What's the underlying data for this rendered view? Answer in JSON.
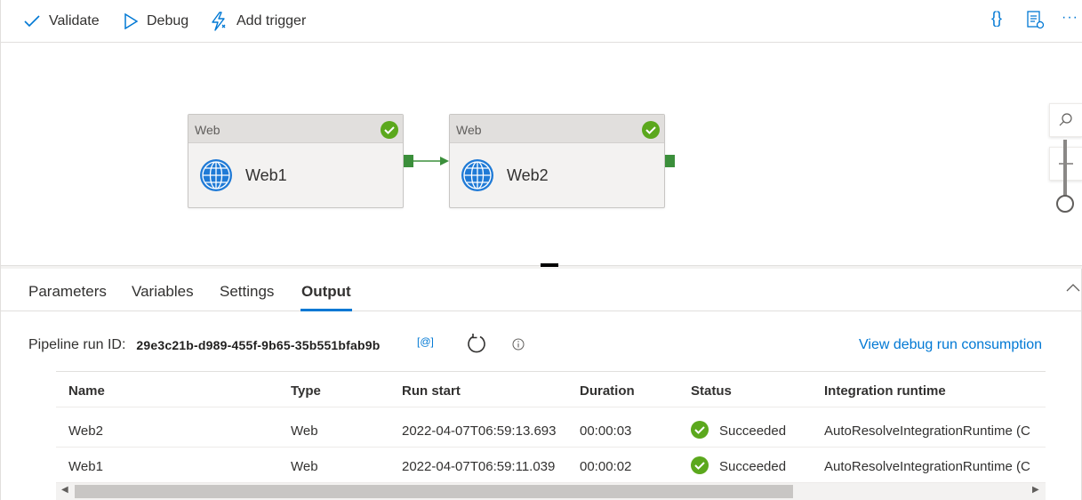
{
  "toolbar": {
    "validate_label": "Validate",
    "debug_label": "Debug",
    "add_trigger_label": "Add trigger",
    "code_icon_text": "{}",
    "more_icon_text": "···"
  },
  "canvas": {
    "activities": [
      {
        "type": "Web",
        "name": "Web1",
        "status": "succeeded"
      },
      {
        "type": "Web",
        "name": "Web2",
        "status": "succeeded"
      }
    ]
  },
  "tabs": [
    {
      "label": "Parameters",
      "active": false
    },
    {
      "label": "Variables",
      "active": false
    },
    {
      "label": "Settings",
      "active": false
    },
    {
      "label": "Output",
      "active": true
    }
  ],
  "output": {
    "run_id_label": "Pipeline run ID:",
    "run_id": "29e3c21b-d989-455f-9b65-35b551bfab9b",
    "copy_label": "[@]",
    "consumption_link": "View debug run consumption",
    "columns": [
      "Name",
      "Type",
      "Run start",
      "Duration",
      "Status",
      "Integration runtime"
    ],
    "rows": [
      {
        "name": "Web2",
        "type": "Web",
        "run_start": "2022-04-07T06:59:13.693",
        "duration": "00:00:03",
        "status": "Succeeded",
        "runtime": "AutoResolveIntegrationRuntime (C"
      },
      {
        "name": "Web1",
        "type": "Web",
        "run_start": "2022-04-07T06:59:11.039",
        "duration": "00:00:02",
        "status": "Succeeded",
        "runtime": "AutoResolveIntegrationRuntime (C"
      }
    ]
  },
  "colors": {
    "accent": "#0078d4",
    "success": "#5ba81d",
    "port": "#3b8f3b"
  }
}
